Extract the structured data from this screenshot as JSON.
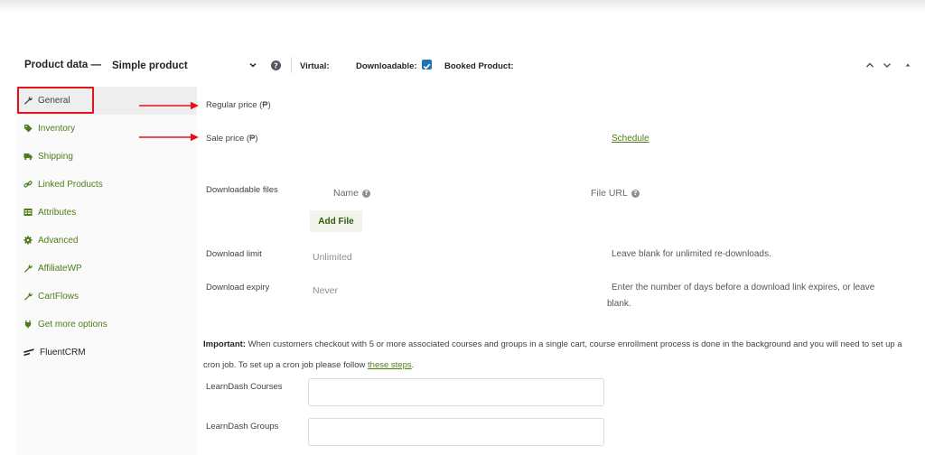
{
  "header": {
    "title": "Product data —",
    "product_type": "Simple product",
    "virtual_label": "Virtual:",
    "downloadable_label": "Downloadable:",
    "booked_label": "Booked Product:"
  },
  "sidebar": {
    "items": [
      {
        "label": "General",
        "icon": "wrench-icon"
      },
      {
        "label": "Inventory",
        "icon": "tag-icon"
      },
      {
        "label": "Shipping",
        "icon": "truck-icon"
      },
      {
        "label": "Linked Products",
        "icon": "link-icon"
      },
      {
        "label": "Attributes",
        "icon": "table-icon"
      },
      {
        "label": "Advanced",
        "icon": "gear-icon"
      },
      {
        "label": "AffiliateWP",
        "icon": "wrench-icon"
      },
      {
        "label": "CartFlows",
        "icon": "wrench-icon"
      },
      {
        "label": "Get more options",
        "icon": "plugin-icon"
      },
      {
        "label": "FluentCRM",
        "icon": "fluentcrm-icon"
      }
    ],
    "active": "General"
  },
  "general": {
    "regular_price_label": "Regular price (₱)",
    "sale_price_label": "Sale price (₱)",
    "schedule_link": "Schedule",
    "downloadable_files_label": "Downloadable files",
    "files_col_name": "Name",
    "files_col_url": "File URL",
    "add_file_button": "Add File",
    "download_limit_label": "Download limit",
    "download_limit_placeholder": "Unlimited",
    "download_limit_desc": "Leave blank for unlimited re-downloads.",
    "download_expiry_label": "Download expiry",
    "download_expiry_placeholder": "Never",
    "download_expiry_desc_1": "Enter the number of days before a download link expires, or leave",
    "download_expiry_desc_2": "blank.",
    "notice_strong": "Important:",
    "notice_text": " When customers checkout with 5 or more associated courses and groups in a single cart, course enrollment process is done in the background and you will need to set up a cron job. To set up a cron job please follow ",
    "notice_link": "these steps",
    "notice_end": ".",
    "learndash_courses_label": "LearnDash Courses",
    "learndash_groups_label": "LearnDash Groups"
  },
  "colors": {
    "link_green": "#4e7d18",
    "annotation_red": "#e3131b",
    "checkbox_blue": "#2271b1"
  }
}
